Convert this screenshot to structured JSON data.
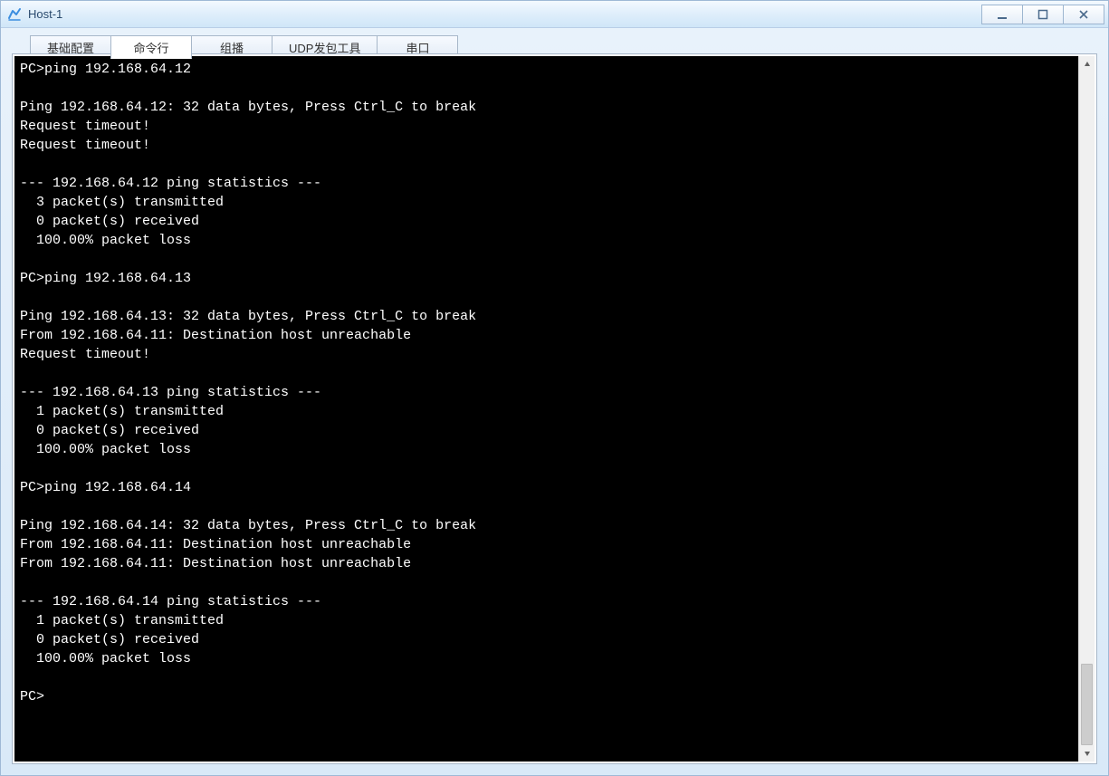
{
  "window": {
    "title": "Host-1"
  },
  "tabs": [
    {
      "label": "基础配置",
      "active": false
    },
    {
      "label": "命令行",
      "active": true
    },
    {
      "label": "组播",
      "active": false
    },
    {
      "label": "UDP发包工具",
      "active": false
    },
    {
      "label": "串口",
      "active": false
    }
  ],
  "terminal_lines": [
    "PC>ping 192.168.64.12",
    "",
    "Ping 192.168.64.12: 32 data bytes, Press Ctrl_C to break",
    "Request timeout!",
    "Request timeout!",
    "",
    "--- 192.168.64.12 ping statistics ---",
    "  3 packet(s) transmitted",
    "  0 packet(s) received",
    "  100.00% packet loss",
    "",
    "PC>ping 192.168.64.13",
    "",
    "Ping 192.168.64.13: 32 data bytes, Press Ctrl_C to break",
    "From 192.168.64.11: Destination host unreachable",
    "Request timeout!",
    "",
    "--- 192.168.64.13 ping statistics ---",
    "  1 packet(s) transmitted",
    "  0 packet(s) received",
    "  100.00% packet loss",
    "",
    "PC>ping 192.168.64.14",
    "",
    "Ping 192.168.64.14: 32 data bytes, Press Ctrl_C to break",
    "From 192.168.64.11: Destination host unreachable",
    "From 192.168.64.11: Destination host unreachable",
    "",
    "--- 192.168.64.14 ping statistics ---",
    "  1 packet(s) transmitted",
    "  0 packet(s) received",
    "  100.00% packet loss",
    "",
    "PC>"
  ]
}
